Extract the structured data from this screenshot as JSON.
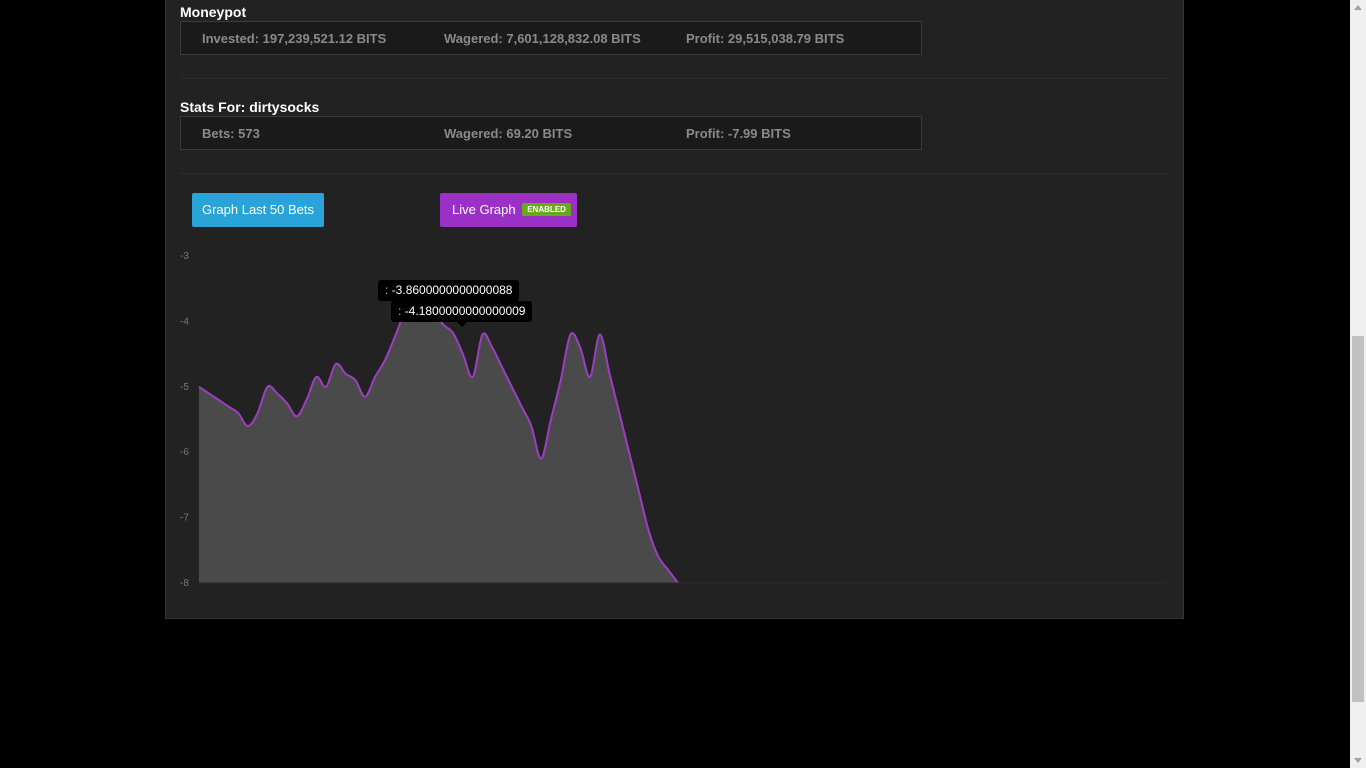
{
  "moneypot": {
    "title": "Moneypot",
    "invested": "Invested: 197,239,521.12 BITS",
    "wagered": "Wagered: 7,601,128,832.08 BITS",
    "profit": "Profit: 29,515,038.79 BITS"
  },
  "user_stats": {
    "title": "Stats For: dirtysocks",
    "bets": "Bets: 573",
    "wagered": "Wagered: 69.20 BITS",
    "profit": "Profit: -7.99 BITS"
  },
  "buttons": {
    "graph_last": "Graph Last 50 Bets",
    "live_graph": "Live Graph",
    "live_badge": "ENABLED"
  },
  "tooltips": [
    {
      "label": ":",
      "value": "-3.8600000000000088"
    },
    {
      "label": ":",
      "value": "-4.1800000000000009"
    }
  ],
  "colors": {
    "graph_button": "#2aa3d9",
    "live_button": "#9b30c7",
    "badge": "#6aaa1a",
    "line": "#9b3fbf",
    "area": "#4a4a4a"
  },
  "chart_data": {
    "type": "area",
    "yticks": [
      "-3",
      "-4",
      "-5",
      "-6",
      "-7",
      "-8"
    ],
    "ylim": [
      -8,
      -3
    ],
    "x": [
      0,
      1,
      2,
      3,
      4,
      5,
      6,
      7,
      8,
      9,
      10,
      11,
      12,
      13,
      14,
      15,
      16,
      17,
      18,
      19,
      20,
      21,
      22,
      23,
      24,
      25,
      26,
      27,
      28,
      29,
      30,
      31,
      32,
      33,
      34,
      35,
      36,
      37,
      38,
      39,
      40,
      41,
      42,
      43,
      44,
      45,
      46,
      47,
      48,
      49
    ],
    "values": [
      -5.0,
      -5.1,
      -5.2,
      -5.3,
      -5.4,
      -5.6,
      -5.4,
      -5.0,
      -5.1,
      -5.25,
      -5.45,
      -5.2,
      -4.85,
      -5.0,
      -4.65,
      -4.8,
      -4.9,
      -5.15,
      -4.85,
      -4.6,
      -4.25,
      -3.9,
      -3.86,
      -3.86,
      -3.86,
      -4.05,
      -4.18,
      -4.5,
      -4.85,
      -4.2,
      -4.4,
      -4.7,
      -5.0,
      -5.3,
      -5.6,
      -6.1,
      -5.5,
      -4.9,
      -4.2,
      -4.4,
      -4.85,
      -4.2,
      -4.8,
      -5.4,
      -6.0,
      -6.6,
      -7.2,
      -7.6,
      -7.8,
      -8.0
    ],
    "grid": false
  }
}
